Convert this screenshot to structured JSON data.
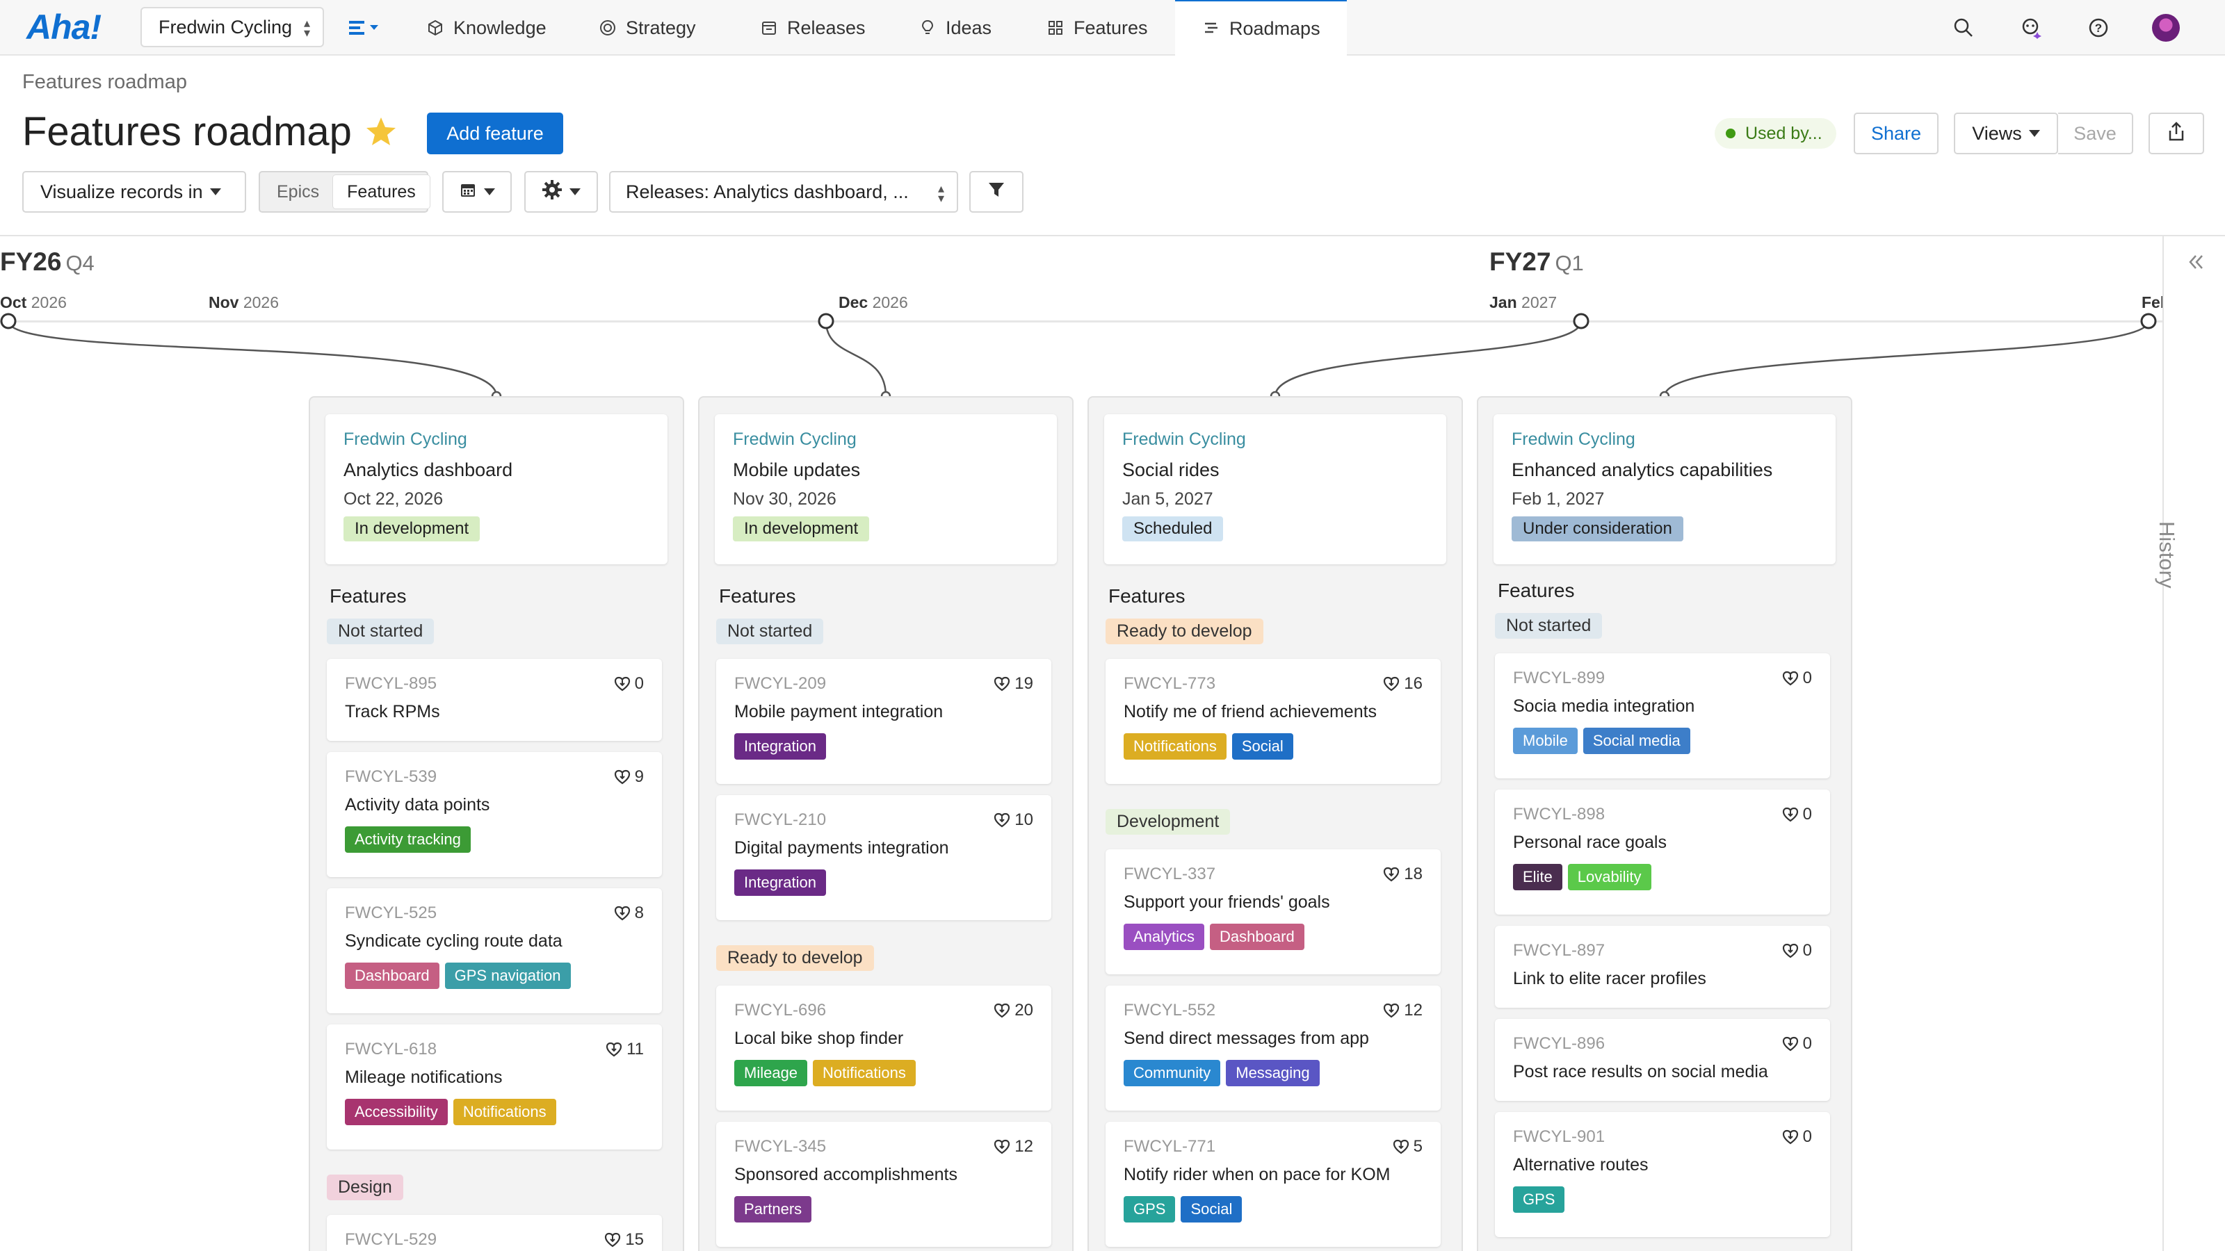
{
  "nav": {
    "logo": "Aha!",
    "workspace": "Fredwin Cycling",
    "items": [
      {
        "label": "Knowledge",
        "icon": "cube-icon"
      },
      {
        "label": "Strategy",
        "icon": "target-icon"
      },
      {
        "label": "Releases",
        "icon": "calendar-icon"
      },
      {
        "label": "Ideas",
        "icon": "lightbulb-icon"
      },
      {
        "label": "Features",
        "icon": "grid-icon"
      },
      {
        "label": "Roadmaps",
        "icon": "roadmap-icon"
      }
    ],
    "active": "Roadmaps"
  },
  "header": {
    "breadcrumb": "Features roadmap",
    "title": "Features roadmap",
    "add_button": "Add feature",
    "used_by": "Used by...",
    "share": "Share",
    "views": "Views",
    "save": "Save"
  },
  "toolbar": {
    "visualize": "Visualize records in",
    "seg_epics": "Epics",
    "seg_features": "Features",
    "releases_filter": "Releases: Analytics dashboard, ..."
  },
  "timeline": {
    "fiscal": [
      {
        "fy": "FY26",
        "q": "Q4"
      },
      {
        "fy": "FY27",
        "q": "Q1"
      }
    ],
    "months": [
      {
        "m": "Oct",
        "y": "2026"
      },
      {
        "m": "Nov",
        "y": "2026"
      },
      {
        "m": "Dec",
        "y": "2026"
      },
      {
        "m": "Jan",
        "y": "2027"
      },
      {
        "m": "Feb",
        "y": ""
      }
    ]
  },
  "history_label": "History",
  "features_label": "Features",
  "colors": {
    "primary": "#0f6fd1",
    "in_development": "#d7edc2",
    "scheduled": "#cfe3f2",
    "under_consideration": "#9fbad5"
  },
  "releases": [
    {
      "workspace": "Fredwin Cycling",
      "name": "Analytics dashboard",
      "date": "Oct 22, 2026",
      "status": "In development",
      "status_bg": "#d7edc2",
      "groups": [
        {
          "label": "Not started",
          "bg": "#dfe8ee",
          "features": [
            {
              "id": "FWCYL-895",
              "name": "Track RPMs",
              "votes": "0",
              "tags": []
            },
            {
              "id": "FWCYL-539",
              "name": "Activity data points",
              "votes": "9",
              "tags": [
                {
                  "t": "Activity tracking",
                  "c": "#3c9b35"
                }
              ]
            },
            {
              "id": "FWCYL-525",
              "name": "Syndicate cycling route data",
              "votes": "8",
              "tags": [
                {
                  "t": "Dashboard",
                  "c": "#c55f83"
                },
                {
                  "t": "GPS navigation",
                  "c": "#3b9ea8"
                }
              ]
            },
            {
              "id": "FWCYL-618",
              "name": "Mileage notifications",
              "votes": "11",
              "tags": [
                {
                  "t": "Accessibility",
                  "c": "#a8346f"
                },
                {
                  "t": "Notifications",
                  "c": "#dcad22"
                }
              ]
            }
          ]
        },
        {
          "label": "Design",
          "bg": "#f1d1dc",
          "features": [
            {
              "id": "FWCYL-529",
              "name": "",
              "votes": "15",
              "tags": []
            }
          ]
        }
      ]
    },
    {
      "workspace": "Fredwin Cycling",
      "name": "Mobile updates",
      "date": "Nov 30, 2026",
      "status": "In development",
      "status_bg": "#d7edc2",
      "groups": [
        {
          "label": "Not started",
          "bg": "#dfe8ee",
          "features": [
            {
              "id": "FWCYL-209",
              "name": "Mobile payment integration",
              "votes": "19",
              "tags": [
                {
                  "t": "Integration",
                  "c": "#6a2a86"
                }
              ]
            },
            {
              "id": "FWCYL-210",
              "name": "Digital payments integration",
              "votes": "10",
              "tags": [
                {
                  "t": "Integration",
                  "c": "#6a2a86"
                }
              ]
            }
          ]
        },
        {
          "label": "Ready to develop",
          "bg": "#fbe0c4",
          "features": [
            {
              "id": "FWCYL-696",
              "name": "Local bike shop finder",
              "votes": "20",
              "tags": [
                {
                  "t": "Mileage",
                  "c": "#2ea54c"
                },
                {
                  "t": "Notifications",
                  "c": "#dcad22"
                }
              ]
            },
            {
              "id": "FWCYL-345",
              "name": "Sponsored accomplishments",
              "votes": "12",
              "tags": [
                {
                  "t": "Partners",
                  "c": "#7c3a8c"
                }
              ]
            }
          ]
        }
      ]
    },
    {
      "workspace": "Fredwin Cycling",
      "name": "Social rides",
      "date": "Jan 5, 2027",
      "status": "Scheduled",
      "status_bg": "#cfe3f2",
      "groups": [
        {
          "label": "Ready to develop",
          "bg": "#fbe0c4",
          "features": [
            {
              "id": "FWCYL-773",
              "name": "Notify me of friend achievements",
              "votes": "16",
              "tags": [
                {
                  "t": "Notifications",
                  "c": "#dcad22"
                },
                {
                  "t": "Social",
                  "c": "#1f6fc6"
                }
              ]
            }
          ]
        },
        {
          "label": "Development",
          "bg": "#e6f1dc",
          "features": [
            {
              "id": "FWCYL-337",
              "name": "Support your friends' goals",
              "votes": "18",
              "tags": [
                {
                  "t": "Analytics",
                  "c": "#9a4fc1"
                },
                {
                  "t": "Dashboard",
                  "c": "#c55f83"
                }
              ]
            },
            {
              "id": "FWCYL-552",
              "name": "Send direct messages from app",
              "votes": "12",
              "tags": [
                {
                  "t": "Community",
                  "c": "#2a88d0"
                },
                {
                  "t": "Messaging",
                  "c": "#5a56c4"
                }
              ]
            },
            {
              "id": "FWCYL-771",
              "name": "Notify rider when on pace for KOM",
              "votes": "5",
              "tags": [
                {
                  "t": "GPS",
                  "c": "#27a39b"
                },
                {
                  "t": "Social",
                  "c": "#1f6fc6"
                }
              ]
            }
          ]
        }
      ]
    },
    {
      "workspace": "Fredwin Cycling",
      "name": "Enhanced analytics capabilities",
      "date": "Feb 1, 2027",
      "status": "Under consideration",
      "status_bg": "#9fbad5",
      "groups": [
        {
          "label": "Not started",
          "bg": "#dfe8ee",
          "features": [
            {
              "id": "FWCYL-899",
              "name": "Socia media integration",
              "votes": "0",
              "tags": [
                {
                  "t": "Mobile",
                  "c": "#5b9bd9"
                },
                {
                  "t": "Social media",
                  "c": "#3d7ec9"
                }
              ]
            },
            {
              "id": "FWCYL-898",
              "name": "Personal race goals",
              "votes": "0",
              "tags": [
                {
                  "t": "Elite",
                  "c": "#4a2d4f"
                },
                {
                  "t": "Lovability",
                  "c": "#5bc94a"
                }
              ]
            },
            {
              "id": "FWCYL-897",
              "name": "Link to elite racer profiles",
              "votes": "0",
              "tags": []
            },
            {
              "id": "FWCYL-896",
              "name": "Post race results on social media",
              "votes": "0",
              "tags": []
            },
            {
              "id": "FWCYL-901",
              "name": "Alternative routes",
              "votes": "0",
              "tags": [
                {
                  "t": "GPS",
                  "c": "#27a39b"
                }
              ]
            }
          ]
        }
      ]
    }
  ]
}
